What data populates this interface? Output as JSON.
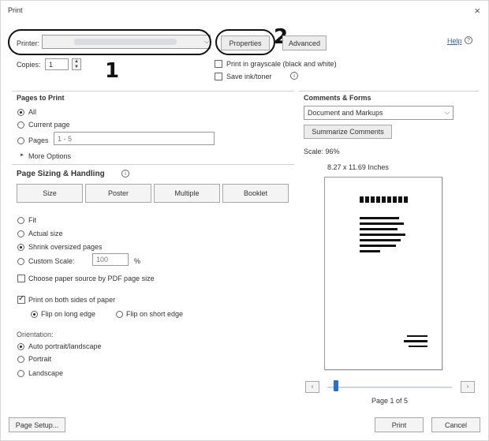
{
  "window": {
    "title": "Print",
    "close_glyph": "×"
  },
  "printer": {
    "label": "Printer:",
    "selected_value": ""
  },
  "buttons": {
    "properties": "Properties",
    "advanced": "Advanced",
    "help": "Help",
    "summarize_comments": "Summarize Comments",
    "size": "Size",
    "poster": "Poster",
    "multiple": "Multiple",
    "booklet": "Booklet",
    "page_setup": "Page Setup...",
    "print": "Print",
    "cancel": "Cancel"
  },
  "copies": {
    "label": "Copies:",
    "value": "1"
  },
  "options": {
    "grayscale": "Print in grayscale (black and white)",
    "save_ink": "Save ink/toner"
  },
  "annotations": {
    "one": "1",
    "two": "2"
  },
  "pages_to_print": {
    "heading": "Pages to Print",
    "all": "All",
    "current_page": "Current page",
    "pages": "Pages",
    "pages_value": "1 - 5",
    "more_options": "More Options"
  },
  "comments_forms": {
    "heading": "Comments & Forms",
    "selected": "Document and Markups"
  },
  "preview": {
    "scale": "Scale: 96%",
    "dimensions": "8.27 x 11.69 Inches",
    "page_indicator": "Page 1 of 5",
    "slider_position": 0.05
  },
  "sizing": {
    "heading": "Page Sizing & Handling",
    "fit": "Fit",
    "actual_size": "Actual size",
    "shrink": "Shrink oversized pages",
    "custom_scale": "Custom Scale:",
    "custom_value": "100",
    "percent": "%",
    "paper_source": "Choose paper source by PDF page size"
  },
  "duplex": {
    "both_sides": "Print on both sides of paper",
    "long_edge": "Flip on long edge",
    "short_edge": "Flip on short edge"
  },
  "orientation": {
    "heading": "Orientation:",
    "auto": "Auto portrait/landscape",
    "portrait": "Portrait",
    "landscape": "Landscape"
  },
  "icons": {
    "help": "help-circle-icon",
    "info": "info-icon",
    "dropdown": "chevron-down-icon",
    "expand": "triangle-right-icon"
  }
}
